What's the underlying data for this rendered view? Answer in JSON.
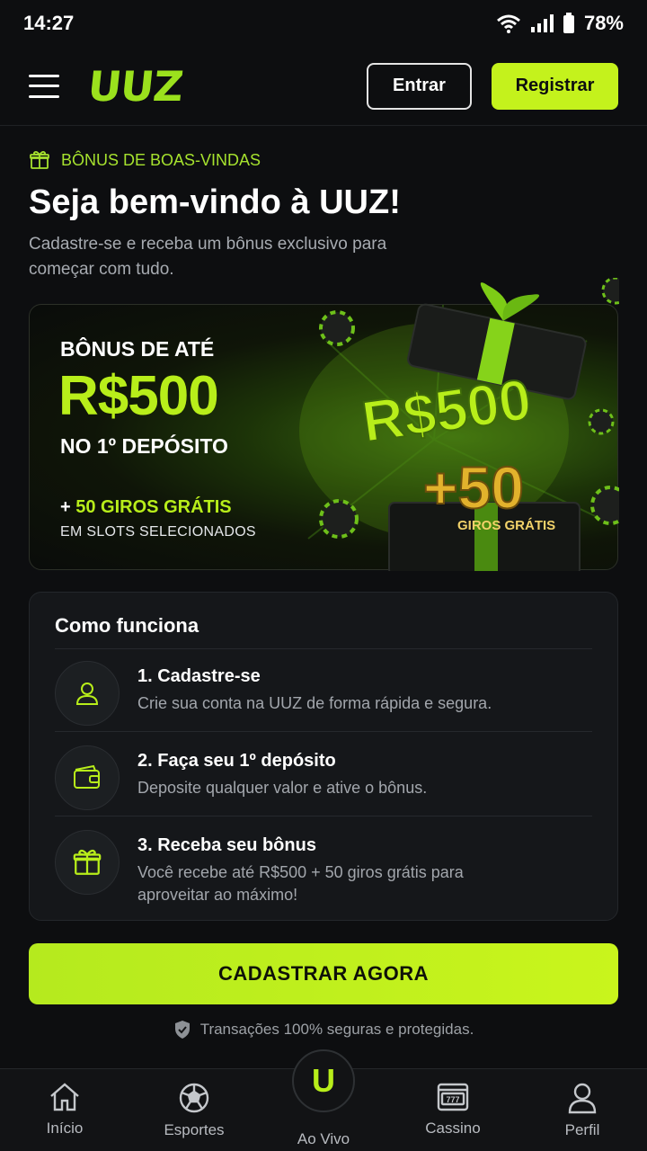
{
  "status": {
    "time": "14:27",
    "battery": "78%"
  },
  "header": {
    "logo": "UUZ",
    "login_label": "Entrar",
    "register_label": "Registrar"
  },
  "welcome": {
    "tag": "BÔNUS DE BOAS-VINDAS",
    "title": "Seja bem-vindo à UUZ!",
    "subtitle": "Cadastre-se e receba um bônus exclusivo para começar com tudo."
  },
  "promo": {
    "line1": "BÔNUS DE ATÉ",
    "amount": "R$500",
    "line3": "NO 1º DEPÓSITO",
    "spins_prefix": "+ ",
    "spins": "50 GIROS GRÁTIS",
    "spins_note": "EM SLOTS SELECIONADOS",
    "art_amount": "R$500",
    "art_plus": "+50",
    "art_spins": "GIROS GRÁTIS",
    "accent": "#b8ee1a"
  },
  "how": {
    "title": "Como funciona",
    "steps": [
      {
        "icon": "user-icon",
        "title": "1. Cadastre-se",
        "desc": "Crie sua conta na UUZ de forma rápida e segura."
      },
      {
        "icon": "wallet-icon",
        "title": "2. Faça seu 1º depósito",
        "desc": "Deposite qualquer valor e ative o bônus."
      },
      {
        "icon": "gift-icon",
        "title": "3. Receba seu bônus",
        "desc": "Você recebe até R$500 + 50 giros grátis para aproveitar ao máximo!"
      }
    ]
  },
  "cta": {
    "label": "CADASTRAR AGORA"
  },
  "secure_note": "Transações 100% seguras e protegidas.",
  "nav": [
    {
      "icon": "home-icon",
      "label": "Início"
    },
    {
      "icon": "soccer-ball-icon",
      "label": "Esportes"
    },
    {
      "icon": "uuz-live-icon",
      "label": "Ao Vivo",
      "glyph": "U"
    },
    {
      "icon": "slot-machine-icon",
      "label": "Cassino",
      "glyph": "777"
    },
    {
      "icon": "profile-icon",
      "label": "Perfil"
    }
  ]
}
